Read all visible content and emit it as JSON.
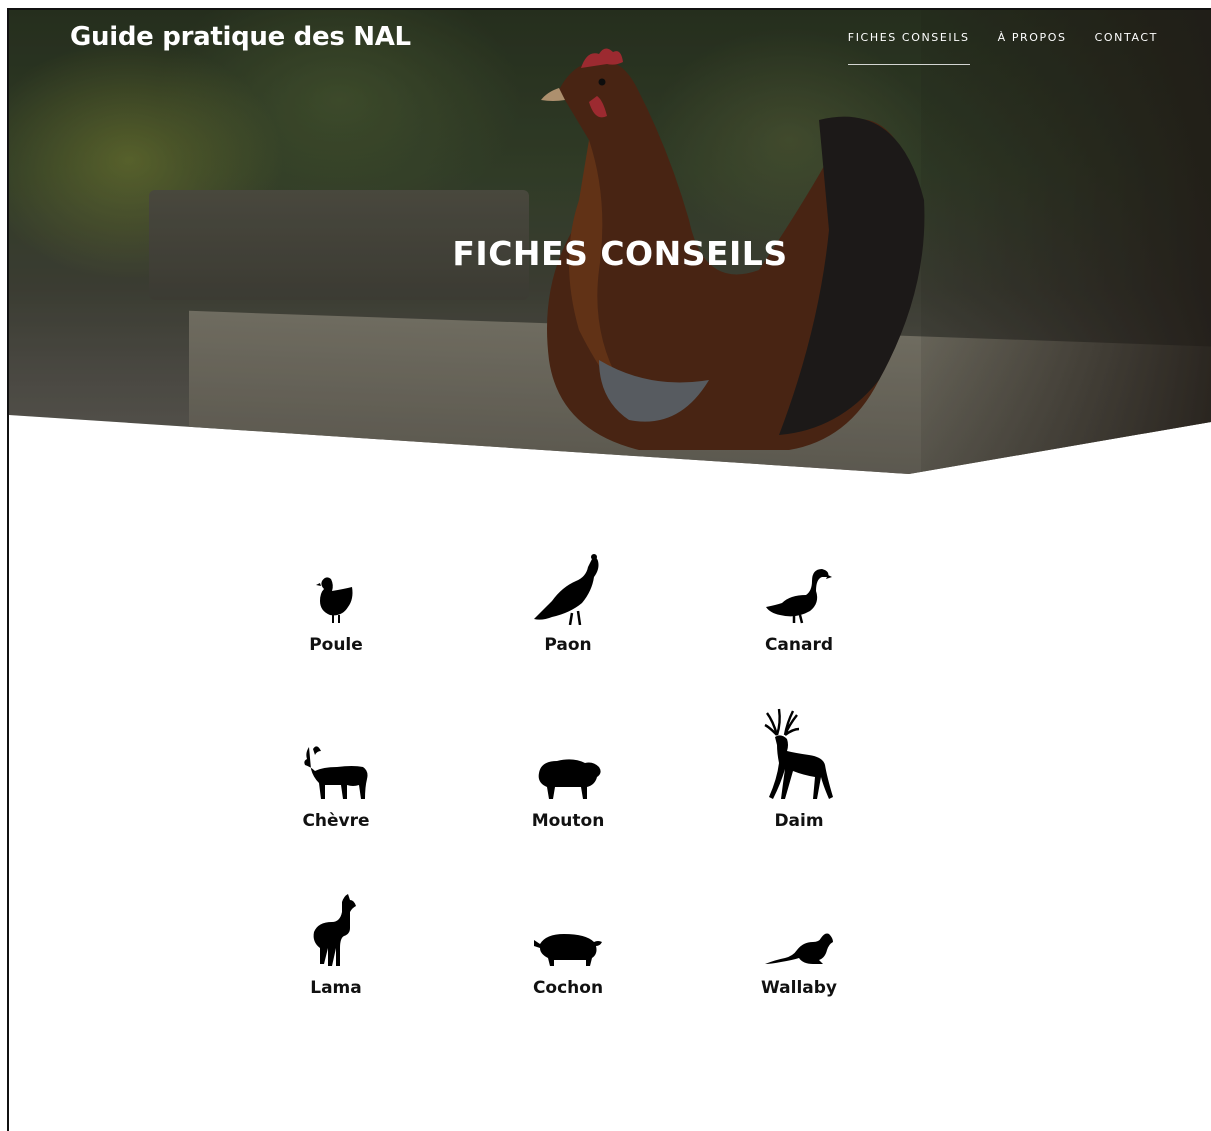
{
  "header": {
    "brand": "Guide pratique des NAL"
  },
  "nav": {
    "items": [
      {
        "label": "FICHES CONSEILS",
        "active": true
      },
      {
        "label": "À PROPOS",
        "active": false
      },
      {
        "label": "CONTACT",
        "active": false
      }
    ]
  },
  "hero": {
    "title": "FICHES CONSEILS"
  },
  "animals": [
    {
      "label": "Poule",
      "icon": "hen-icon"
    },
    {
      "label": "Paon",
      "icon": "peacock-icon"
    },
    {
      "label": "Canard",
      "icon": "duck-icon"
    },
    {
      "label": "Chèvre",
      "icon": "goat-icon"
    },
    {
      "label": "Mouton",
      "icon": "sheep-icon"
    },
    {
      "label": "Daim",
      "icon": "deer-icon"
    },
    {
      "label": "Lama",
      "icon": "llama-icon"
    },
    {
      "label": "Cochon",
      "icon": "pig-icon"
    },
    {
      "label": "Wallaby",
      "icon": "wallaby-icon"
    }
  ]
}
